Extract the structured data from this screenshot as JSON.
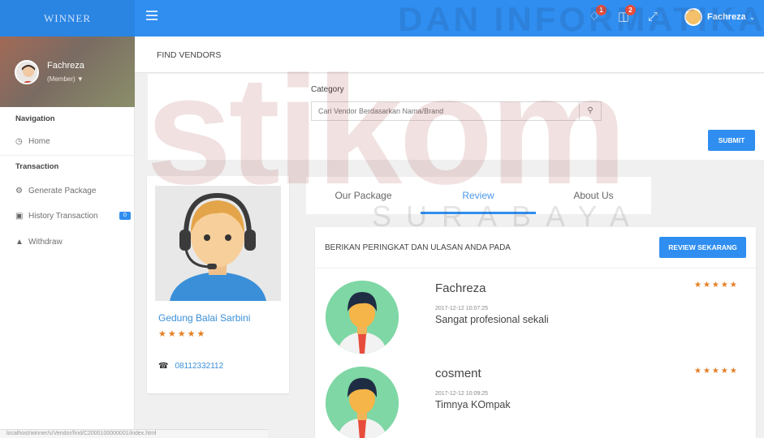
{
  "topbar": {
    "logo_text": "WINNER",
    "notifications_count": "1",
    "cart_count": "2",
    "user_name": "Fachreza"
  },
  "sidebar": {
    "profile_name": "Fachreza",
    "profile_role": "(Member)",
    "nav_heading": "Navigation",
    "home_label": "Home",
    "transaction_heading": "Transaction",
    "items": [
      {
        "label": "Generate Package"
      },
      {
        "label": "History Transaction",
        "badge": "0"
      },
      {
        "label": "Withdraw"
      }
    ]
  },
  "page": {
    "title": "FIND VENDORS",
    "category_label": "Category",
    "search_placeholder": "Cari Vendor Berdasarkan Nama/Brand",
    "submit_label": "SUBMIT"
  },
  "vendor": {
    "name": "Gedung Balai Sarbini",
    "stars": "★★★★★",
    "phone": "08112332112"
  },
  "tabs": [
    {
      "label": "Our Package"
    },
    {
      "label": "Review"
    },
    {
      "label": "About Us"
    }
  ],
  "review": {
    "heading": "BERIKAN PERINGKAT DAN ULASAN ANDA PADA",
    "button_label": "REVIEW SEKARANG",
    "items": [
      {
        "name": "Fachreza",
        "date": "2017-12-12 10:07:25",
        "text": "Sangat profesional sekali",
        "stars": "★★★★★"
      },
      {
        "name": "cosment",
        "date": "2017-12-12 10:09:25",
        "text": "Timnya KOmpak",
        "stars": "★★★★★"
      }
    ]
  },
  "statusbar": {
    "url": "localhost/winner/s/Vendor/find/C2000100000001/index.html"
  },
  "watermark": {
    "top": "DAN INFORMATIKA",
    "main": "stikom",
    "sub": "SURABAYA"
  },
  "colors": {
    "accent": "#2f8ef0",
    "star": "#e67e22",
    "link": "#3b8fd8"
  }
}
